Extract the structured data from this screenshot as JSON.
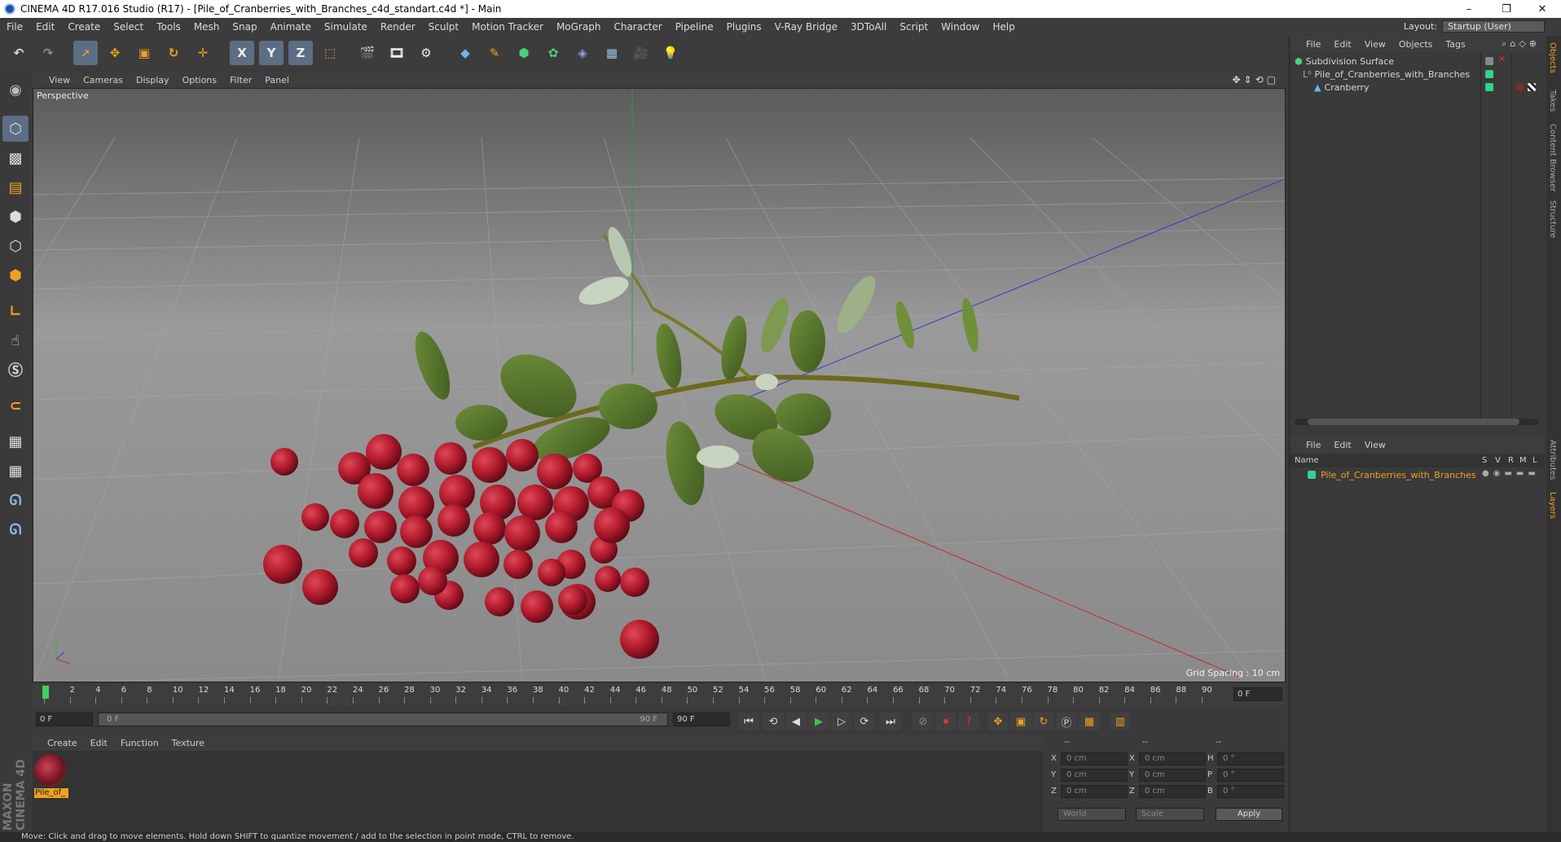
{
  "window": {
    "title": "CINEMA 4D R17.016 Studio (R17) - [Pile_of_Cranberries_with_Branches_c4d_standart.c4d *] - Main",
    "minimize": "–",
    "restore": "❐",
    "close": "✕"
  },
  "menu": [
    "File",
    "Edit",
    "Create",
    "Select",
    "Tools",
    "Mesh",
    "Snap",
    "Animate",
    "Simulate",
    "Render",
    "Sculpt",
    "Motion Tracker",
    "MoGraph",
    "Character",
    "Pipeline",
    "Plugins",
    "V-Ray Bridge",
    "3DToAll",
    "Script",
    "Window",
    "Help"
  ],
  "layout": {
    "label": "Layout:",
    "value": "Startup (User)"
  },
  "toolbar": {
    "axis_x": "X",
    "axis_y": "Y",
    "axis_z": "Z"
  },
  "viewport": {
    "menu": [
      "View",
      "Cameras",
      "Display",
      "Options",
      "Filter",
      "Panel"
    ],
    "label": "Perspective",
    "grid_spacing": "Grid Spacing : 10 cm"
  },
  "timeline": {
    "ticks": [
      "0",
      "2",
      "4",
      "6",
      "8",
      "10",
      "12",
      "14",
      "16",
      "18",
      "20",
      "22",
      "24",
      "26",
      "28",
      "30",
      "32",
      "34",
      "36",
      "38",
      "40",
      "42",
      "44",
      "46",
      "48",
      "50",
      "52",
      "54",
      "56",
      "58",
      "60",
      "62",
      "64",
      "66",
      "68",
      "70",
      "72",
      "74",
      "76",
      "78",
      "80",
      "82",
      "84",
      "86",
      "88",
      "90"
    ],
    "current_frame": "0 F",
    "start_field": "0 F",
    "range_start": "0 F",
    "range_end": "90 F",
    "end_field": "90 F"
  },
  "material_panel": {
    "menu": [
      "Create",
      "Edit",
      "Function",
      "Texture"
    ],
    "material_name": "Pile_of_"
  },
  "coords": {
    "header_a": "--",
    "header_b": "--",
    "header_c": "--",
    "x_label": "X",
    "y_label": "Y",
    "z_label": "Z",
    "x_pos": "0 cm",
    "y_pos": "0 cm",
    "z_pos": "0 cm",
    "x_size": "0 cm",
    "y_size": "0 cm",
    "z_size": "0 cm",
    "h_label": "H",
    "p_label": "P",
    "b_label": "B",
    "h_val": "0 °",
    "p_val": "0 °",
    "b_val": "0 °",
    "world": "World",
    "scale": "Scale",
    "apply": "Apply"
  },
  "object_manager": {
    "menu": [
      "File",
      "Edit",
      "View",
      "Objects",
      "Tags"
    ],
    "items": [
      {
        "name": "Subdivision Surface"
      },
      {
        "name": "Pile_of_Cranberries_with_Branches"
      },
      {
        "name": "Cranberry"
      }
    ]
  },
  "layer_manager": {
    "menu": [
      "File",
      "Edit",
      "View"
    ],
    "col_name": "Name",
    "cols": [
      "S",
      "V",
      "R",
      "M",
      "L"
    ],
    "layer_name": "Pile_of_Cranberries_with_Branches"
  },
  "right_tabs": [
    "Objects",
    "Takes",
    "Content Browser",
    "Structure",
    "Attributes",
    "Layers"
  ],
  "branding": "MAXON CINEMA 4D",
  "status": "Move: Click and drag to move elements. Hold down SHIFT to quantize movement / add to the selection in point mode, CTRL to remove.",
  "colors": {
    "accent_orange": "#f0a020",
    "selected_blue": "#5d6d84",
    "layer_green": "#2fd58a"
  }
}
